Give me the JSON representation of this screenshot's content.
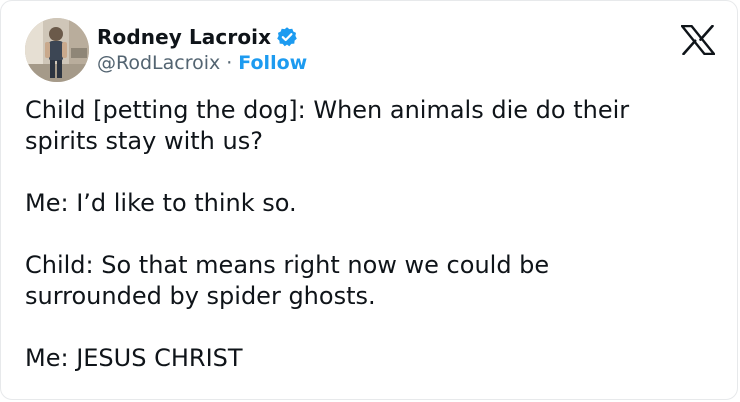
{
  "tweet": {
    "author": {
      "display_name": "Rodney Lacroix",
      "handle": "@RodLacroix",
      "separator": "·",
      "follow_label": "Follow",
      "verified": true
    },
    "paragraphs": [
      "Child [petting the dog]: When animals die do their\nspirits stay with us?",
      "Me: I’d like to think so.",
      "Child: So that means right now we could be\nsurrounded by spider ghosts.",
      "Me: JESUS CHRIST"
    ]
  },
  "icons": {
    "verified": "verified-badge-icon",
    "platform": "x-logo-icon"
  },
  "colors": {
    "text_primary": "#0f1419",
    "text_secondary": "#536471",
    "accent": "#1d9bf0",
    "border": "#e7e9eb"
  }
}
